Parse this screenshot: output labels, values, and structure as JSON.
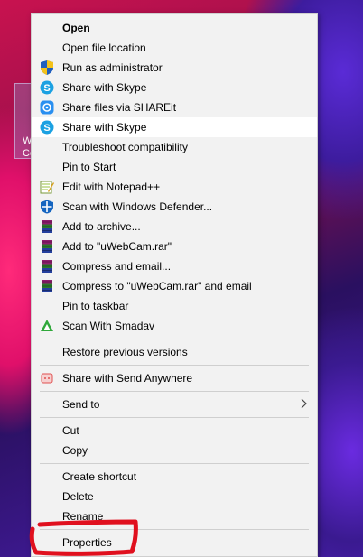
{
  "desktop_icon": {
    "label": "W\nCo"
  },
  "menu": {
    "items": [
      {
        "label": "Open",
        "icon": "none"
      },
      {
        "label": "Open file location",
        "icon": "none"
      },
      {
        "label": "Run as administrator",
        "icon": "uac-shield-icon"
      },
      {
        "label": "Share with Skype",
        "icon": "skype-icon"
      },
      {
        "label": "Share files via SHAREit",
        "icon": "shareit-icon"
      },
      {
        "label": "Share with Skype",
        "icon": "skype-icon"
      },
      {
        "label": "Troubleshoot compatibility",
        "icon": "none"
      },
      {
        "label": "Pin to Start",
        "icon": "none"
      },
      {
        "label": "Edit with Notepad++",
        "icon": "notepadpp-icon"
      },
      {
        "label": "Scan with Windows Defender...",
        "icon": "defender-icon"
      },
      {
        "label": "Add to archive...",
        "icon": "winrar-icon"
      },
      {
        "label": "Add to \"uWebCam.rar\"",
        "icon": "winrar-icon"
      },
      {
        "label": "Compress and email...",
        "icon": "winrar-icon"
      },
      {
        "label": "Compress to \"uWebCam.rar\" and email",
        "icon": "winrar-icon"
      },
      {
        "label": "Pin to taskbar",
        "icon": "none"
      },
      {
        "label": "Scan With Smadav",
        "icon": "smadav-icon"
      },
      {
        "label": "Restore previous versions",
        "icon": "none"
      },
      {
        "label": "Share with Send Anywhere",
        "icon": "send-anywhere-icon"
      },
      {
        "label": "Send to",
        "icon": "none"
      },
      {
        "label": "Cut",
        "icon": "none"
      },
      {
        "label": "Copy",
        "icon": "none"
      },
      {
        "label": "Create shortcut",
        "icon": "none"
      },
      {
        "label": "Delete",
        "icon": "none"
      },
      {
        "label": "Rename",
        "icon": "none"
      },
      {
        "label": "Properties",
        "icon": "none"
      }
    ]
  },
  "colors": {
    "menu_bg": "#f2f2f2",
    "highlight": "#ffffff",
    "annotation_red": "#e0101e"
  }
}
